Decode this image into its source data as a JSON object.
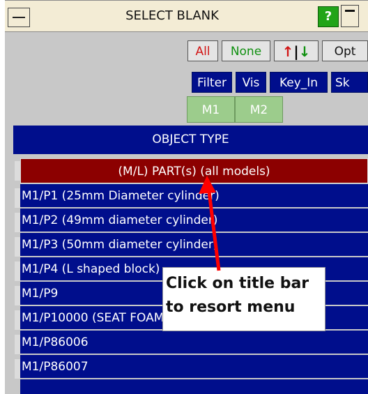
{
  "window": {
    "title": "SELECT BLANK",
    "help_label": "?"
  },
  "toolbar": {
    "all_label": "All",
    "none_label": "None",
    "sort_up": "↑",
    "sort_divider": "|",
    "sort_down": "↓",
    "opt_label": "Opt",
    "filter_label": "Filter",
    "vis_label": "Vis",
    "key_in_label": "Key_In",
    "sk_label": "Sk"
  },
  "models": [
    "M1",
    "M2"
  ],
  "object_type_label": "OBJECT TYPE",
  "part_row_label": "(M/L) PART(s) (all models)",
  "rows": [
    "M1/P1 (25mm Diameter cylinder)",
    "M1/P2 (49mm diameter cylinder)",
    "M1/P3 (50mm diameter cylinder)",
    "M1/P4 (L shaped block)",
    "M1/P9",
    "M1/P10000 (SEAT FOAM SOLIDS)",
    "M1/P86006",
    "M1/P86007"
  ],
  "callout": {
    "line1": "Click on title bar",
    "line2": "to resort menu"
  },
  "colors": {
    "title_bg": "#f3ecd5",
    "accent_blue": "#000e8c",
    "part_row_red": "#8c0000",
    "arrow_red": "#ff0000",
    "help_green": "#22a418",
    "model_green": "#9ccc8c"
  },
  "icons": [
    "minus-icon",
    "help-icon",
    "minimize-icon",
    "arrow-up-icon",
    "arrow-down-icon"
  ]
}
